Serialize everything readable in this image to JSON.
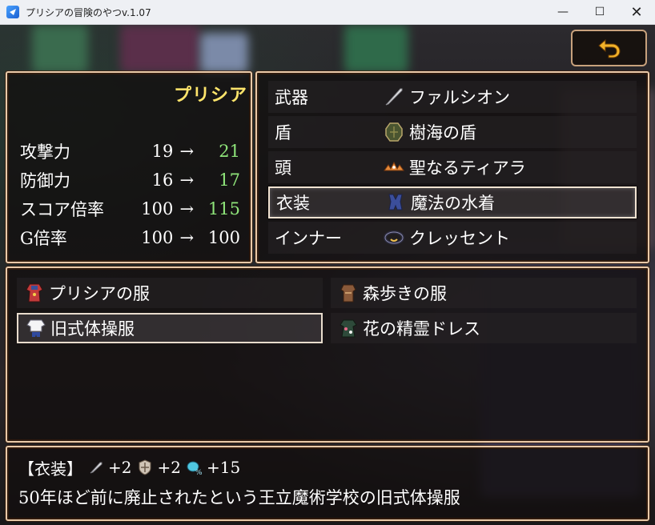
{
  "window": {
    "title": "プリシアの冒険のやつv.1.07",
    "minimize_glyph": "—",
    "maximize_glyph": "☐",
    "close_glyph": "✕"
  },
  "actor": {
    "name": "プリシア",
    "stats": [
      {
        "label": "攻撃力",
        "current": "19",
        "arrow": "→",
        "new": "21",
        "improved": true
      },
      {
        "label": "防御力",
        "current": "16",
        "arrow": "→",
        "new": "17",
        "improved": true
      },
      {
        "label": "スコア倍率",
        "current": "100",
        "arrow": "→",
        "new": "115",
        "improved": true
      },
      {
        "label": "G倍率",
        "current": "100",
        "arrow": "→",
        "new": "100",
        "improved": false
      }
    ]
  },
  "equip_slots": [
    {
      "slot": "武器",
      "item": "ファルシオン",
      "icon": "sword-icon"
    },
    {
      "slot": "盾",
      "item": "樹海の盾",
      "icon": "shield-icon"
    },
    {
      "slot": "頭",
      "item": "聖なるティアラ",
      "icon": "tiara-icon"
    },
    {
      "slot": "衣装",
      "item": "魔法の水着",
      "icon": "swimsuit-icon",
      "selected": true
    },
    {
      "slot": "インナー",
      "item": "クレッセント",
      "icon": "ring-icon"
    }
  ],
  "items": [
    {
      "name": "プリシアの服",
      "icon": "dress-red-icon"
    },
    {
      "name": "森歩きの服",
      "icon": "forest-clothes-icon"
    },
    {
      "name": "旧式体操服",
      "icon": "gym-uniform-icon",
      "selected": true
    },
    {
      "name": "花の精霊ドレス",
      "icon": "flower-dress-icon"
    }
  ],
  "help": {
    "category": "【衣装】",
    "bonus_attack": "+2",
    "bonus_defense": "+2",
    "bonus_score": "+15",
    "description": "50年ほど前に廃止されたという王立魔術学校の旧式体操服"
  },
  "colors": {
    "frame": "#e9c9a8",
    "name": "#ffe56b",
    "increase": "#8fe57a"
  }
}
